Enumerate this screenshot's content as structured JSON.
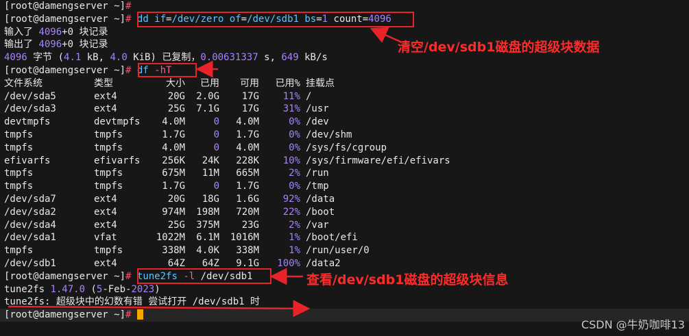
{
  "terminal": {
    "prompt": "[root@damengserver ~]",
    "hash": "#",
    "dd": {
      "cmd_a": "dd if",
      "cmd_b": "=",
      "cmd_c": "/dev/zero of",
      "cmd_d": "=",
      "cmd_e": "/dev/sdb1 bs",
      "cmd_f": "=",
      "bs": "1",
      "cmd_g": " count",
      "cmd_h": "=",
      "count": "4096",
      "in_label": "输入了 ",
      "in_val": "4096",
      "in_rest": "+0 块记录",
      "out_label": "输出了 ",
      "out_val": "4096",
      "out_rest": "+0 块记录",
      "sum_a": "4096",
      "sum_b": " 字节 (",
      "sum_c": "4.1",
      "sum_d": " kB, ",
      "sum_e": "4.0",
      "sum_f": " KiB) 已复制，",
      "sum_g": "0.00631337",
      "sum_h": " s, ",
      "sum_i": "649",
      "sum_j": " kB/s"
    },
    "df": {
      "cmd": "df",
      "flag": "-hT",
      "header": [
        "文件系统",
        "类型",
        "大小",
        "已用",
        "可用",
        "已用%",
        "挂载点"
      ],
      "rows": [
        [
          "/dev/sda5",
          "ext4",
          "20G",
          "2.0G",
          "17G",
          "11%",
          "/"
        ],
        [
          "/dev/sda3",
          "ext4",
          "25G",
          "7.1G",
          "17G",
          "31%",
          "/usr"
        ],
        [
          "devtmpfs",
          "devtmpfs",
          "4.0M",
          "0",
          "4.0M",
          "0%",
          "/dev"
        ],
        [
          "tmpfs",
          "tmpfs",
          "1.7G",
          "0",
          "1.7G",
          "0%",
          "/dev/shm"
        ],
        [
          "tmpfs",
          "tmpfs",
          "4.0M",
          "0",
          "4.0M",
          "0%",
          "/sys/fs/cgroup"
        ],
        [
          "efivarfs",
          "efivarfs",
          "256K",
          "24K",
          "228K",
          "10%",
          "/sys/firmware/efi/efivars"
        ],
        [
          "tmpfs",
          "tmpfs",
          "675M",
          "11M",
          "665M",
          "2%",
          "/run"
        ],
        [
          "tmpfs",
          "tmpfs",
          "1.7G",
          "0",
          "1.7G",
          "0%",
          "/tmp"
        ],
        [
          "/dev/sda7",
          "ext4",
          "20G",
          "18G",
          "1.6G",
          "92%",
          "/data"
        ],
        [
          "/dev/sda2",
          "ext4",
          "974M",
          "198M",
          "720M",
          "22%",
          "/boot"
        ],
        [
          "/dev/sda4",
          "ext4",
          "25G",
          "375M",
          "23G",
          "2%",
          "/var"
        ],
        [
          "/dev/sda1",
          "vfat",
          "1022M",
          "6.1M",
          "1016M",
          "1%",
          "/boot/efi"
        ],
        [
          "tmpfs",
          "tmpfs",
          "338M",
          "4.0K",
          "338M",
          "1%",
          "/run/user/0"
        ],
        [
          "/dev/sdb1",
          "ext4",
          "64Z",
          "64Z",
          "9.1G",
          "100%",
          "/data2"
        ]
      ]
    },
    "tune2fs": {
      "cmd": "tune2fs",
      "flag": " -l",
      "arg": " /dev/sdb1",
      "ver_a": "tune2fs ",
      "ver_b": "1.47.0",
      "ver_c": " (",
      "ver_d": "5",
      "ver_e": "-Feb-",
      "ver_f": "2023",
      "ver_g": ")",
      "err": "tune2fs: 超级块中的幻数有错 尝试打开 /dev/sdb1 时"
    }
  },
  "annotations": {
    "dd_note": "清空/dev/sdb1磁盘的超级块数据",
    "tune_note": "查看/dev/sdb1磁盘的超级块信息",
    "color": "#e8232a"
  },
  "watermark": "CSDN @牛奶咖啡13"
}
